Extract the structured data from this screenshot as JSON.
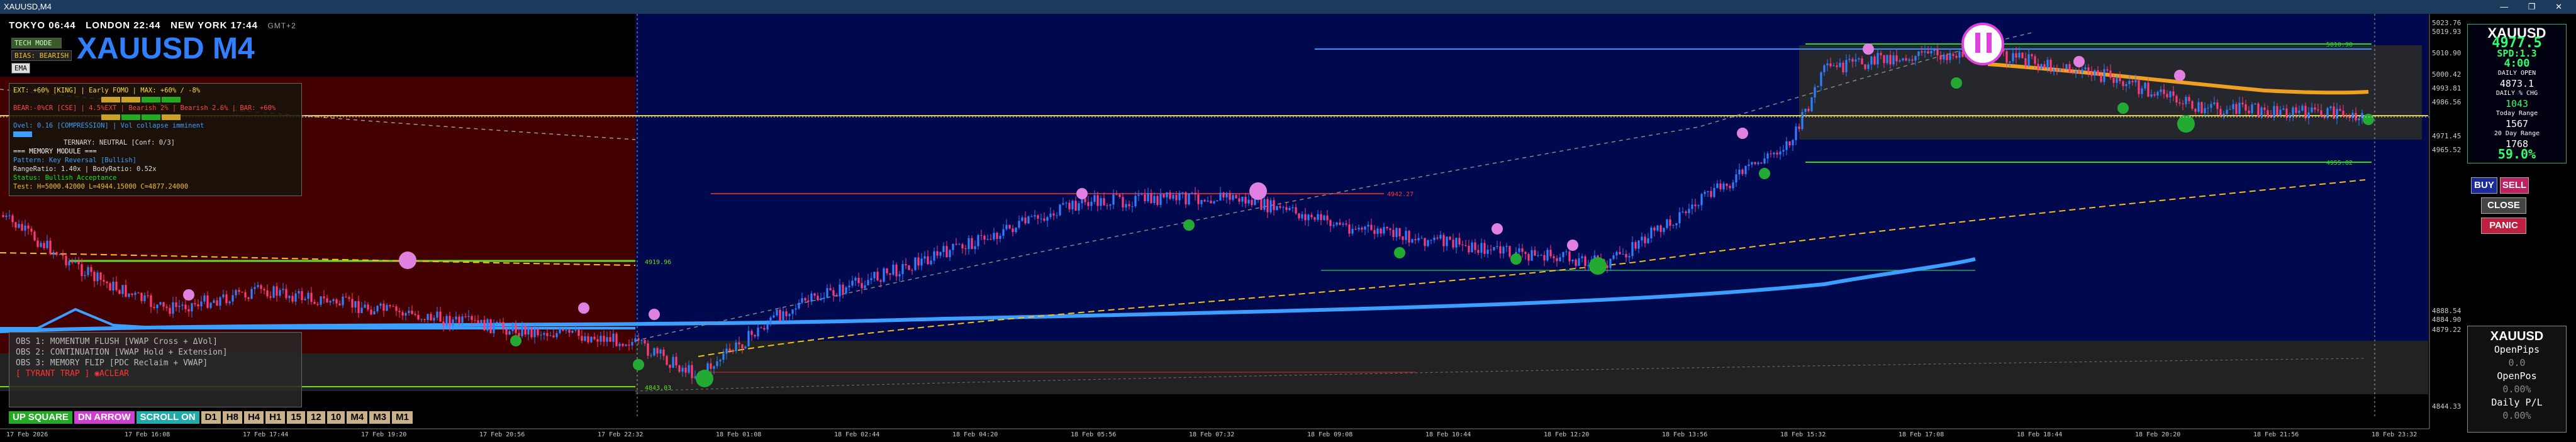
{
  "window": {
    "title": "XAUUSD,M4",
    "buttons": "—  ❐  ✕"
  },
  "clock": {
    "tokyo": "TOKYO 06:44",
    "london": "LONDON 22:44",
    "new_york": "NEW YORK 17:44",
    "gmt": "GMT+2"
  },
  "symbol_title": "XAUUSD M4",
  "mini_buttons": {
    "top": "TECH MODE",
    "bias": "BIAS: BEARISH",
    "small": "EMA"
  },
  "info_panel": {
    "line1": "EXT: +60% [KING] | Early FOMO | MAX: +60% / -8%",
    "line2": "BEAR:-0%CR [CSE] | 4.5%EXT | Bearish 2% | Bearish 2.6% | BAR: +60%",
    "line3": "Ovel: 0.16 [COMPRESSION] | Vol collapse imminent",
    "line4": "TERNARY: NEUTRAL [Conf: 0/3]",
    "line5": "=== MEMORY MODULE ===",
    "line6": "Pattern: Key Reversal [Bullish]",
    "line7": "RangeRatio: 1.40x | BodyRatio: 0.52x",
    "line8": "Status: Bullish Acceptance",
    "line9": "Test: H=5000.42000 L=4944.15000 C=4877.24000"
  },
  "obs_panel": {
    "line1": "OBS 1: MOMENTUM FLUSH [VWAP Cross + ΔVol]",
    "line2": "OBS 2: CONTINUATION [VWAP Hold + Extension]",
    "line3": "OBS 3: MEMORY FLIP [PDC Reclaim + VWAP]",
    "line4": "[ TYRANT TRAP ]  ◉ACLEAR"
  },
  "bottom_bar": {
    "up": "UP SQUARE",
    "dn": "DN ARROW",
    "scroll": "SCROLL ON",
    "tf": [
      "D1",
      "H8",
      "H4",
      "H1",
      "15",
      "12",
      "10",
      "M4",
      "M3",
      "M1"
    ]
  },
  "right_panel": {
    "title": "XAUUSD",
    "price": "4977.5",
    "spread": "SPD:1.3",
    "timer": "4:00",
    "daily_open_label": "DAILY OPEN",
    "daily_open": "4873.1",
    "daily_pct_label": "DAILY % CHG",
    "daily_pct": "1043",
    "today_range_label": "Today Range",
    "today_range": "1567",
    "avg_range_label": "20 Day Range",
    "avg_range": "1768",
    "range_pct": "59.0%"
  },
  "actions": {
    "buy": "BUY",
    "sell": "SELL",
    "close": "CLOSE",
    "panic": "PANIC"
  },
  "right_panel2": {
    "title": "XAUUSD",
    "open_pips_label": "OpenPips",
    "open_pips": "0.0",
    "open_pos_label": "OpenPos",
    "open_pos": "0.00%",
    "daily_pl_label": "Daily P/L",
    "daily_pl": "0.00%"
  },
  "price_axis": [
    "5023.76",
    "5019.93",
    "5010.90",
    "5000.42",
    "4993.81",
    "4986.56",
    "4971.45",
    "4965.52",
    "4888.54",
    "4884.90",
    "4879.22",
    "4844.33"
  ],
  "time_axis": [
    "17 Feb 2026",
    "17 Feb 16:08",
    "17 Feb 17:44",
    "17 Feb 19:20",
    "17 Feb 20:56",
    "17 Feb 22:32",
    "18 Feb 01:08",
    "18 Feb 02:44",
    "18 Feb 04:20",
    "18 Feb 05:56",
    "18 Feb 07:32",
    "18 Feb 09:08",
    "18 Feb 10:44",
    "18 Feb 12:20",
    "18 Feb 13:56",
    "18 Feb 15:32",
    "18 Feb 17:08",
    "18 Feb 18:44",
    "18 Feb 20:20",
    "18 Feb 21:56",
    "18 Feb 23:32"
  ],
  "level_labels": {
    "l1": "4919.96",
    "l2": "4843.03",
    "l3": "4942.27",
    "l4": "5010.90",
    "l5": "4955.82"
  },
  "colors": {
    "bull": "#2f7fff",
    "bear": "#ff3a7a",
    "zone_red": "#5a0000",
    "zone_blue": "#000a55",
    "vwap": "#3a9fff",
    "ema": "#f0a020"
  }
}
